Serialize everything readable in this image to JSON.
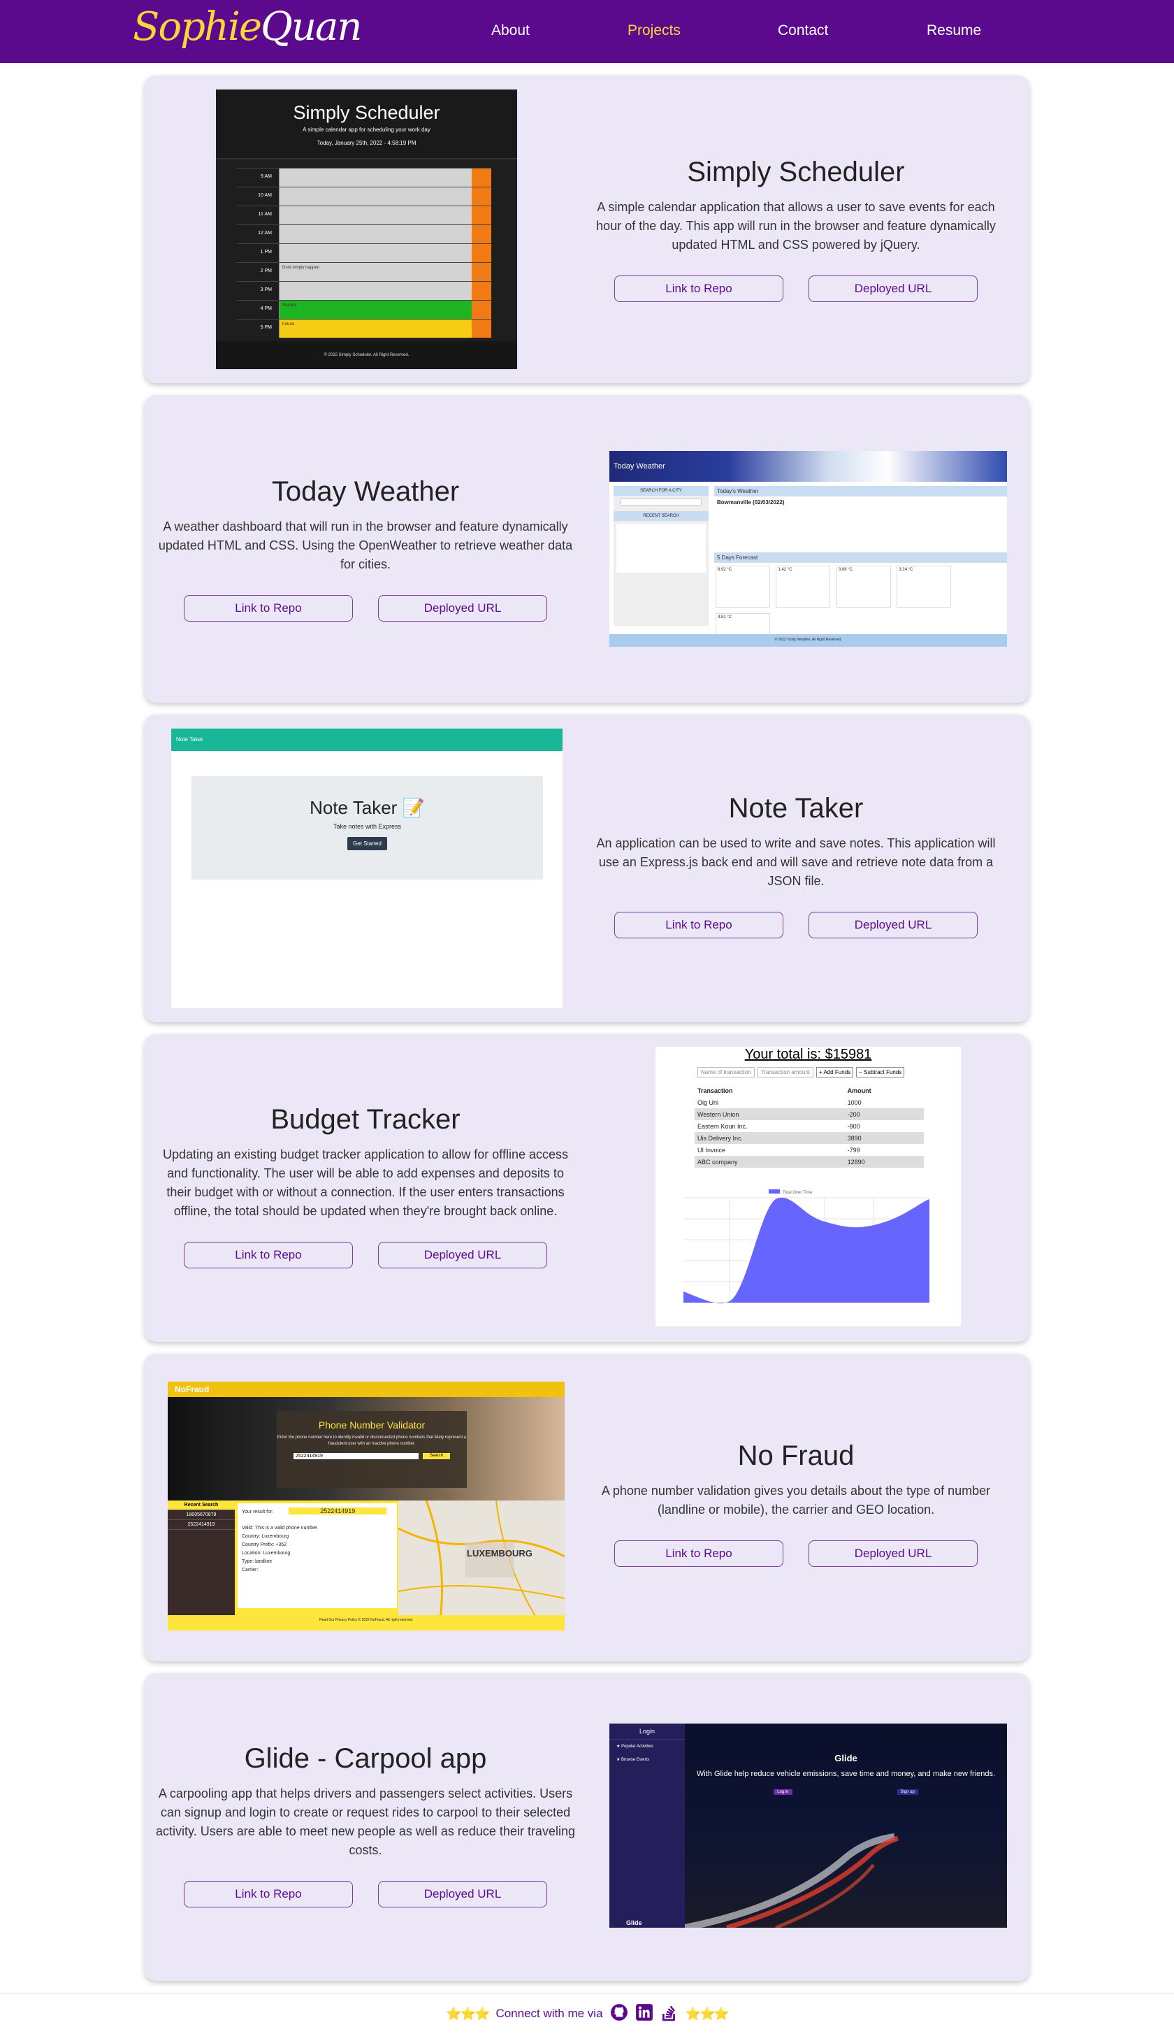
{
  "nav": {
    "logo_first": "Sophie",
    "logo_last": "Quan",
    "links": [
      {
        "label": "About"
      },
      {
        "label": "Projects",
        "active": true
      },
      {
        "label": "Contact"
      },
      {
        "label": "Resume"
      }
    ]
  },
  "colors": {
    "nav_bg": "#5b0a8e",
    "accent": "#ffd43b",
    "card_bg": "#ece7f7"
  },
  "projects": [
    {
      "title": "Simply Scheduler",
      "description": "A simple calendar application that allows a user to save events for each hour of the day. This app will run in the browser and feature dynamically updated HTML and CSS powered by jQuery.",
      "repo_label": "Link to Repo",
      "deploy_label": "Deployed URL",
      "preview": {
        "app_title": "Simply Scheduler",
        "subtitle": "A simple calendar app for scheduling your work day",
        "date": "Today, January 25th, 2022 - 4:58:19 PM",
        "hours": [
          "9 AM",
          "10 AM",
          "11 AM",
          "12 AM",
          "1 PM",
          "2 PM",
          "3 PM",
          "4 PM",
          "5 PM"
        ],
        "entries": [
          "",
          "",
          "",
          "",
          "",
          "Dont simply happen",
          "",
          "Present",
          "Future"
        ],
        "footer": "© 2022 Simply Scheduler. All Right Reserved."
      }
    },
    {
      "title": "Today Weather",
      "description": "A weather dashboard that will run in the browser and feature dynamically updated HTML and CSS. Using the OpenWeather to retrieve weather data for cities.",
      "repo_label": "Link to Repo",
      "deploy_label": "Deployed URL",
      "preview": {
        "app_title": "Today Weather",
        "search_label": "SEARCH FOR A CITY",
        "recent_label": "RECENT SEARCH",
        "today_label": "Today's Weather",
        "city": "Bowmanville (02/03/2022)",
        "forecast_label": "5 Days Forecast",
        "temps": [
          "6.92 °C",
          "1.42 °C",
          "3.08 °C",
          "3.24 °C",
          "4.81 °C"
        ],
        "footer": "© 2022 Today Weather. All Right Reserved."
      }
    },
    {
      "title": "Note Taker",
      "description": "An application can be used to write and save notes. This application will use an Express.js back end and will save and retrieve note data from a JSON file.",
      "repo_label": "Link to Repo",
      "deploy_label": "Deployed URL",
      "preview": {
        "header": "Note Taker",
        "title": "Note Taker 📝",
        "subtitle": "Take notes with Express",
        "button": "Get Started"
      }
    },
    {
      "title": "Budget Tracker",
      "description": "Updating an existing budget tracker application to allow for offline access and functionality. The user will be able to add expenses and deposits to their budget with or without a connection. If the user enters transactions offline, the total should be updated when they're brought back online.",
      "repo_label": "Link to Repo",
      "deploy_label": "Deployed URL",
      "preview": {
        "total": "Your total is: $15981",
        "name_placeholder": "Name of transaction",
        "amount_placeholder": "Transaction amount",
        "add_label": "+ Add Funds",
        "subtract_label": "− Subtract Funds",
        "col_transaction": "Transaction",
        "col_amount": "Amount",
        "rows": [
          {
            "name": "Oig Uni",
            "amount": "1000"
          },
          {
            "name": "Western Union",
            "amount": "-200"
          },
          {
            "name": "Eastern Koun Inc.",
            "amount": "-800"
          },
          {
            "name": "Uis Delivery Inc.",
            "amount": "3890"
          },
          {
            "name": "UI Invoice",
            "amount": "-799"
          },
          {
            "name": "ABC company",
            "amount": "12890"
          }
        ],
        "legend": "Total Over Time"
      }
    },
    {
      "title": "No Fraud",
      "description": "A phone number validation gives you details about the type of number (landline or mobile), the carrier and GEO location.",
      "repo_label": "Link to Repo",
      "deploy_label": "Deployed URL",
      "preview": {
        "brand": "NoFraud",
        "modal_title": "Phone Number Validator",
        "modal_text": "Enter the phone number here to identify invalid or disconnected phone numbers that likely represent a fraudulent user with an inactive phone number.",
        "input_value": "2522414919",
        "search_label": "Search",
        "recent_label": "Recent Search",
        "recent_items": [
          "18005670678",
          "2522414919"
        ],
        "result_label": "Your result for:",
        "result_number": "2522414919",
        "result_lines": [
          "Valid: This is a valid phone number",
          "Country: Luxembourg",
          "Country Prefix: +352",
          "Location: Luxembourg",
          "Type: landline",
          "Carrier:"
        ],
        "map_label": "LUXEMBOURG",
        "footer": "Read Our Privacy Policy © 2022 NoFraud. All right reserved."
      }
    },
    {
      "title": "Glide - Carpool app",
      "description": "A carpooling app that helps drivers and passengers select activities. Users can signup and login to create or request rides to carpool to their selected activity. Users are able to meet new people as well as reduce their traveling costs.",
      "repo_label": "Link to Repo",
      "deploy_label": "Deployed URL",
      "preview": {
        "login": "Login",
        "side_items": [
          "Popular Activities",
          "Browse Events"
        ],
        "brand": "Glide",
        "tagline": "With Glide help reduce vehicle emissions, save time and money, and make new friends.",
        "login_btn": "Log in",
        "signup_btn": "Sign up"
      }
    }
  ],
  "footer": {
    "stars": "⭐⭐⭐",
    "text": "Connect with me via",
    "icons": [
      "github-icon",
      "linkedin-icon",
      "stackoverflow-icon"
    ]
  }
}
